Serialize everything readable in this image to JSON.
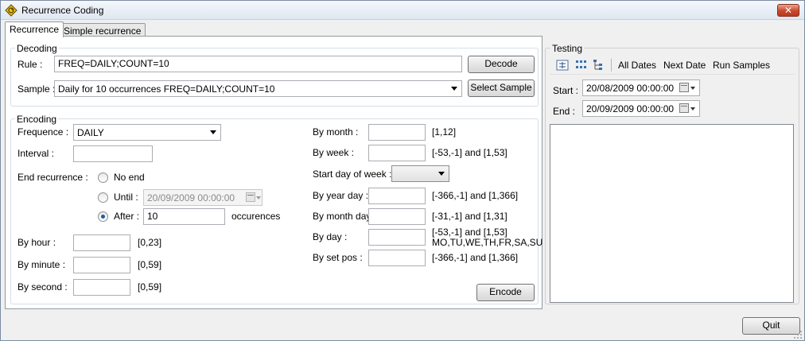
{
  "window": {
    "title": "Recurrence Coding",
    "close_label": "✕"
  },
  "tabs": [
    {
      "label": "Recurrence",
      "active": true
    },
    {
      "label": "Simple recurrence",
      "active": false
    }
  ],
  "decoding": {
    "legend": "Decoding",
    "rule_label": "Rule :",
    "rule_value": "FREQ=DAILY;COUNT=10",
    "decode_button": "Decode",
    "sample_label": "Sample :",
    "sample_value": "Daily for 10 occurrences FREQ=DAILY;COUNT=10",
    "select_sample_button": "Select Sample"
  },
  "encoding": {
    "legend": "Encoding",
    "frequence_label": "Frequence :",
    "frequence_value": "DAILY",
    "interval_label": "Interval :",
    "interval_value": "",
    "end_recurrence_label": "End recurrence :",
    "no_end_label": "No end",
    "until_label": "Until :",
    "until_value": "20/09/2009 00:00:00",
    "after_label": "After :",
    "after_value": "10",
    "occurences_label": "occurences",
    "selected_end": "after",
    "by_hour_label": "By hour :",
    "by_hour_range": "[0,23]",
    "by_minute_label": "By minute :",
    "by_minute_range": "[0,59]",
    "by_second_label": "By second :",
    "by_second_range": "[0,59]",
    "by_month_label": "By month :",
    "by_month_range": "[1,12]",
    "by_week_label": "By week :",
    "by_week_range": "[-53,-1] and [1,53]",
    "start_day_of_week_label": "Start day of week :",
    "start_day_of_week_value": "",
    "by_year_day_label": "By year day :",
    "by_year_day_range": "[-366,-1] and [1,366]",
    "by_month_day_label": "By month day :",
    "by_month_day_range": "[-31,-1] and [1,31]",
    "by_day_label": "By day :",
    "by_day_range_1": "[-53,-1] and [1,53]",
    "by_day_range_2": "MO,TU,WE,TH,FR,SA,SU",
    "by_set_pos_label": "By set pos :",
    "by_set_pos_range": "[-366,-1] and [1,366]",
    "encode_button": "Encode"
  },
  "testing": {
    "legend": "Testing",
    "toolbar": {
      "icons": [
        "expand-icon",
        "list-icon",
        "tree-icon"
      ],
      "all_dates": "All Dates",
      "next_date": "Next Date",
      "run_samples": "Run Samples"
    },
    "start_label": "Start :",
    "start_value": "20/08/2009 00:00:00",
    "end_label": "End :",
    "end_value": "20/09/2009 00:00:00"
  },
  "footer": {
    "quit_button": "Quit"
  },
  "colors": {
    "radio_checked": "#1d5f9f",
    "close_button": "#c9472c"
  }
}
